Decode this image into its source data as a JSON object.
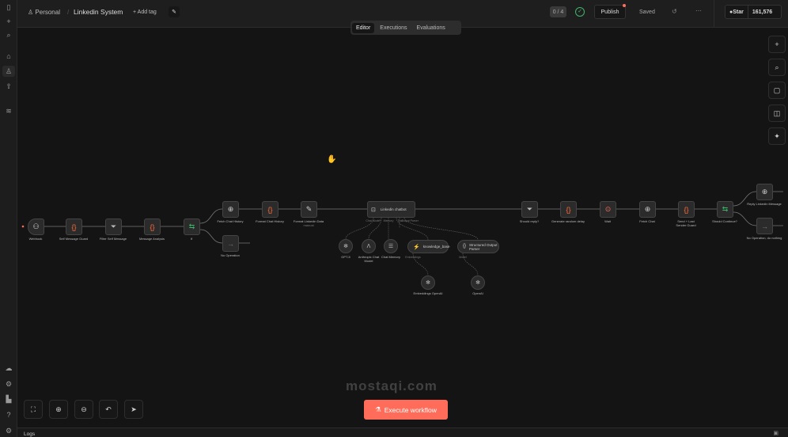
{
  "header": {
    "project": "Personal",
    "workflow": "Linkedin System",
    "add_tag": "+ Add tag",
    "counter": "0 / 4",
    "publish": "Publish",
    "saved": "Saved",
    "star": "Star",
    "star_count": "161,576"
  },
  "tabs": [
    "Editor",
    "Executions",
    "Evaluations"
  ],
  "nodes": {
    "webhook": "Webhook",
    "self_guard": "Self Message Guard",
    "filter_self": "Filter Self Message",
    "analysis": "Message Analysis",
    "if": "If",
    "fetch_history": "Fetch Chat History",
    "noop": "No Operation",
    "format_history": "Format Chat History",
    "format_linkedin": "Format Linkedin Data",
    "format_linkedin_sub": "manual",
    "agent": "Linkedin chatbot",
    "should_reply": "Should reply?",
    "delay": "Generate random delay",
    "wait": "Wait",
    "fetch_chat": "Fetch Chat",
    "send_guard": "Send + Last Sender Guard",
    "should_continue": "Should Continue?",
    "reply": "Reply Linkedin Message",
    "noop2": "No Operation, do nothing",
    "gpt5": "GPT-5",
    "anthropic": "Anthropic Chat Model",
    "memory": "Chat Memory",
    "kb": "knowledge_base",
    "parser": "Structured Output Parser",
    "embeddings": "Embeddings OpenAI",
    "openai": "OpenAI"
  },
  "handles": {
    "chat_model": "Chat Model*",
    "memory": "Memory",
    "tool": "Tool",
    "output_parser": "Output Parser",
    "model": "Model",
    "embeddings": "Embeddings",
    "true": "true",
    "false": "false"
  },
  "execute": "Execute workflow",
  "logs": "Logs",
  "watermark": "mostaqi.com",
  "colors": {
    "accent": "#ff6d5a",
    "code": "#ff6d3a",
    "green": "#3fb56b"
  }
}
